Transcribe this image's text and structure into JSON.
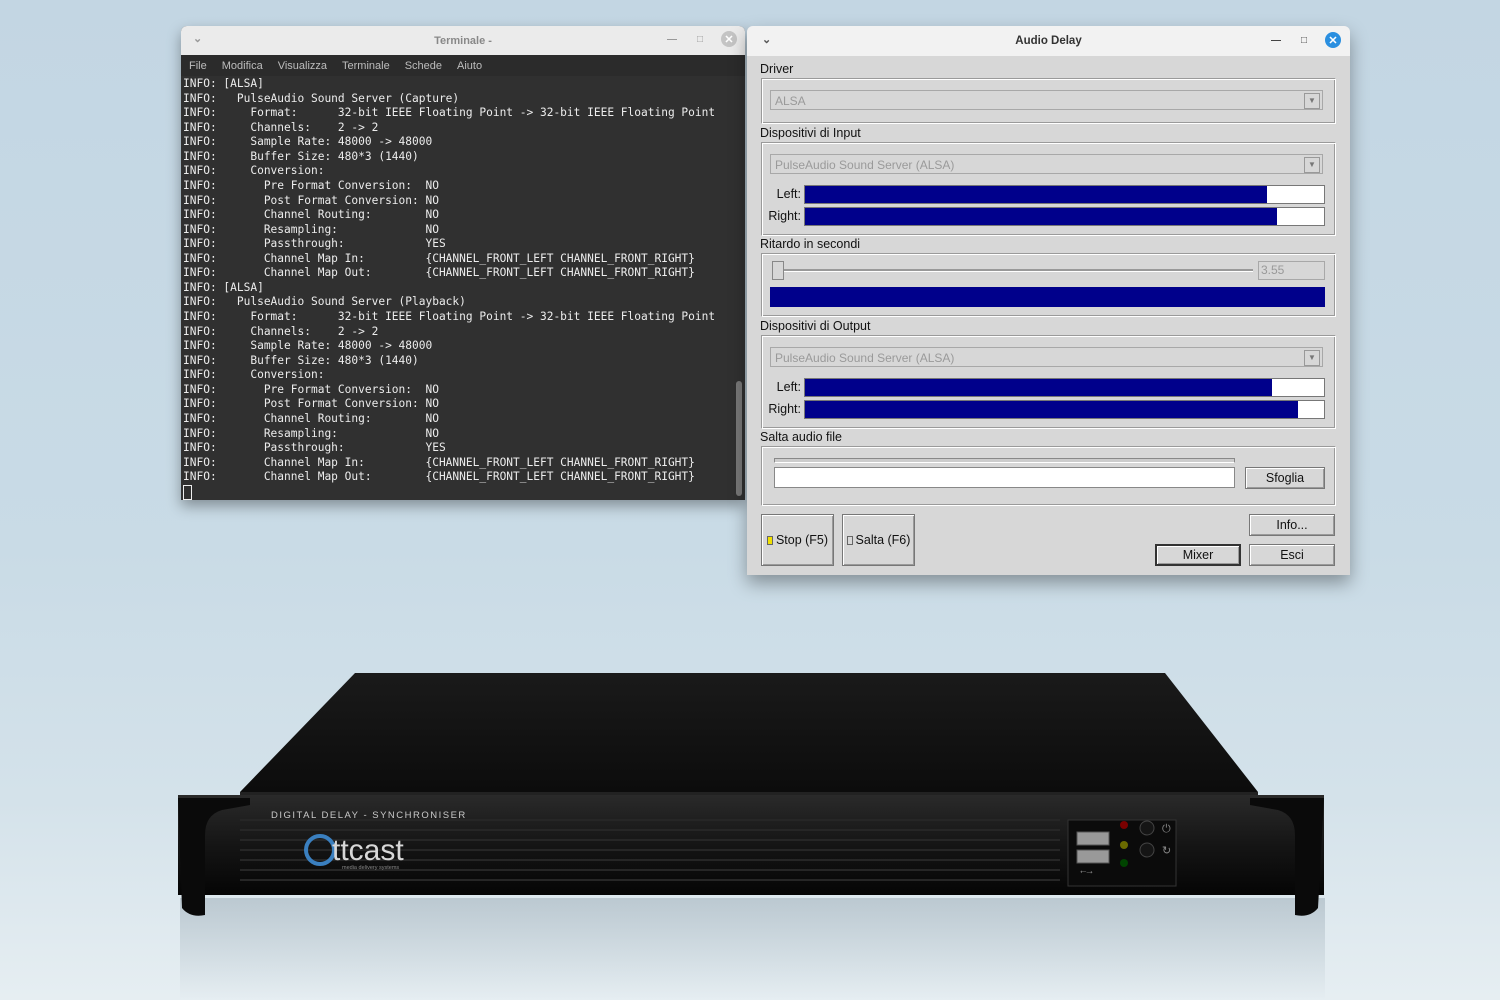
{
  "terminal": {
    "title": "Terminale -",
    "menu": [
      "File",
      "Modifica",
      "Visualizza",
      "Terminale",
      "Schede",
      "Aiuto"
    ],
    "lines": [
      "INFO: [ALSA]",
      "INFO:   PulseAudio Sound Server (Capture)",
      "INFO:     Format:      32-bit IEEE Floating Point -> 32-bit IEEE Floating Point",
      "INFO:     Channels:    2 -> 2",
      "INFO:     Sample Rate: 48000 -> 48000",
      "INFO:     Buffer Size: 480*3 (1440)",
      "INFO:     Conversion:",
      "INFO:       Pre Format Conversion:  NO",
      "INFO:       Post Format Conversion: NO",
      "INFO:       Channel Routing:        NO",
      "INFO:       Resampling:             NO",
      "INFO:       Passthrough:            YES",
      "INFO:       Channel Map In:         {CHANNEL_FRONT_LEFT CHANNEL_FRONT_RIGHT}",
      "INFO:       Channel Map Out:        {CHANNEL_FRONT_LEFT CHANNEL_FRONT_RIGHT}",
      "INFO: [ALSA]",
      "INFO:   PulseAudio Sound Server (Playback)",
      "INFO:     Format:      32-bit IEEE Floating Point -> 32-bit IEEE Floating Point",
      "INFO:     Channels:    2 -> 2",
      "INFO:     Sample Rate: 48000 -> 48000",
      "INFO:     Buffer Size: 480*3 (1440)",
      "INFO:     Conversion:",
      "INFO:       Pre Format Conversion:  NO",
      "INFO:       Post Format Conversion: NO",
      "INFO:       Channel Routing:        NO",
      "INFO:       Resampling:             NO",
      "INFO:       Passthrough:            YES",
      "INFO:       Channel Map In:         {CHANNEL_FRONT_LEFT CHANNEL_FRONT_RIGHT}",
      "INFO:       Channel Map Out:        {CHANNEL_FRONT_LEFT CHANNEL_FRONT_RIGHT}"
    ]
  },
  "audio_delay": {
    "title": "Audio Delay",
    "driver": {
      "label": "Driver",
      "value": "ALSA"
    },
    "input": {
      "label": "Dispositivi di Input",
      "device": "PulseAudio Sound Server (ALSA)",
      "left_label": "Left:",
      "right_label": "Right:",
      "left_level": 0.89,
      "right_level": 0.91
    },
    "delay": {
      "label": "Ritardo in secondi",
      "value": "3.55"
    },
    "output": {
      "label": "Dispositivi di Output",
      "device": "PulseAudio Sound Server (ALSA)",
      "left_label": "Left:",
      "right_label": "Right:",
      "left_level": 0.9,
      "right_level": 0.95
    },
    "skip_file": {
      "label": "Salta audio file",
      "browse": "Sfoglia"
    },
    "buttons": {
      "stop": "Stop (F5)",
      "skip": "Salta (F6)",
      "info": "Info...",
      "mixer": "Mixer",
      "exit": "Esci"
    },
    "colors": {
      "meter": "#00008b",
      "stop_indicator": "#f0e000"
    }
  },
  "device": {
    "label": "DIGITAL DELAY - SYNCHRONISER",
    "brand": "ttcast",
    "tagline": "media delivery systems"
  }
}
